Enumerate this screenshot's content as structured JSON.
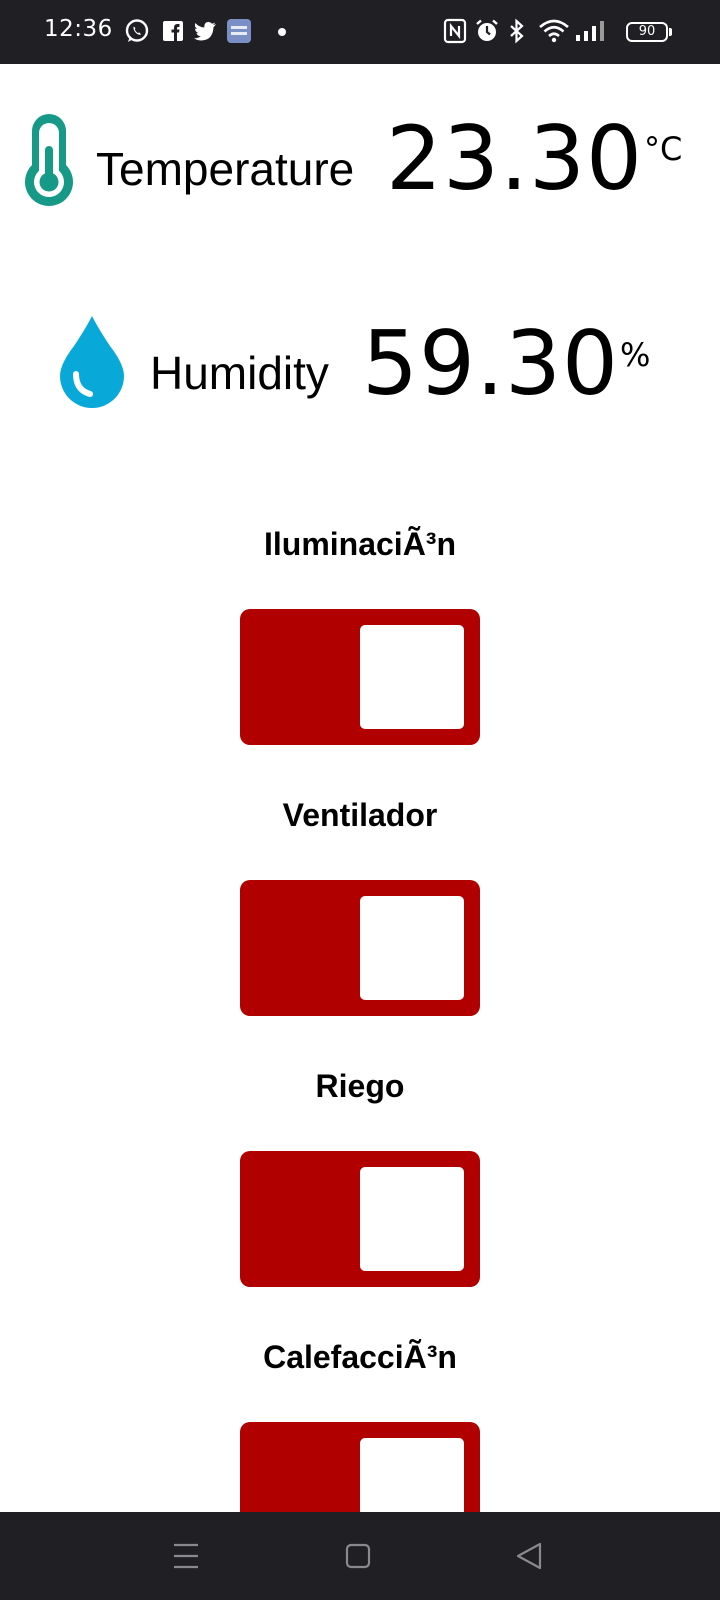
{
  "status_bar": {
    "time": "12:36",
    "notification_icons": [
      "whatsapp-icon",
      "facebook-icon",
      "twitter-icon",
      "app-icon",
      "dot-icon"
    ],
    "system_icons": [
      "nfc-icon",
      "alarm-icon",
      "bluetooth-icon",
      "wifi-icon",
      "signal-icon"
    ],
    "battery": "90"
  },
  "readings": {
    "temperature": {
      "label": "Temperature",
      "value": "23.30",
      "unit": "°C",
      "icon": "thermometer-icon",
      "color": "#169a87"
    },
    "humidity": {
      "label": "Humidity",
      "value": "59.30",
      "unit": "%",
      "icon": "water-drop-icon",
      "color": "#08a9d9"
    }
  },
  "toggles": [
    {
      "label": "IluminaciÃ³n",
      "state": "off",
      "color": "#b10000"
    },
    {
      "label": "Ventilador",
      "state": "off",
      "color": "#b10000"
    },
    {
      "label": "Riego",
      "state": "off",
      "color": "#b10000"
    },
    {
      "label": "CalefacciÃ³n",
      "state": "off",
      "color": "#b10000"
    }
  ],
  "nav_bar": {
    "buttons": [
      "menu-icon",
      "home-icon",
      "back-icon"
    ]
  }
}
